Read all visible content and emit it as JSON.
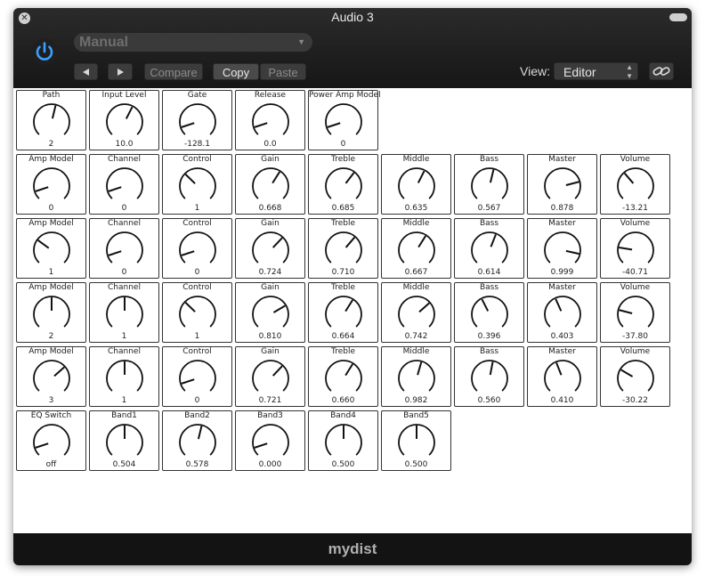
{
  "window": {
    "title": "Audio 3",
    "footer": "mydist"
  },
  "toolbar": {
    "preset": "Manual",
    "compare": "Compare",
    "copy": "Copy",
    "paste": "Paste",
    "view_label": "View:",
    "view_value": "Editor"
  },
  "knob_rows": [
    [
      {
        "label": "Path",
        "value": "2",
        "level": 0.55
      },
      {
        "label": "Input Level",
        "value": "10.0",
        "level": 0.6
      },
      {
        "label": "Gate",
        "value": "-128.1",
        "level": 0.1
      },
      {
        "label": "Release",
        "value": "0.0",
        "level": 0.1
      },
      {
        "label": "Power Amp Model",
        "value": "0",
        "level": 0.1
      }
    ],
    [
      {
        "label": "Amp Model",
        "value": "0",
        "level": 0.1
      },
      {
        "label": "Channel",
        "value": "0",
        "level": 0.1
      },
      {
        "label": "Control",
        "value": "1",
        "level": 0.33
      },
      {
        "label": "Gain",
        "value": "0.668",
        "level": 0.62
      },
      {
        "label": "Treble",
        "value": "0.685",
        "level": 0.64
      },
      {
        "label": "Middle",
        "value": "0.635",
        "level": 0.6
      },
      {
        "label": "Bass",
        "value": "0.567",
        "level": 0.55
      },
      {
        "label": "Master",
        "value": "0.878",
        "level": 0.78
      },
      {
        "label": "Volume",
        "value": "-13.21",
        "level": 0.35
      }
    ],
    [
      {
        "label": "Amp Model",
        "value": "1",
        "level": 0.3
      },
      {
        "label": "Channel",
        "value": "0",
        "level": 0.1
      },
      {
        "label": "Control",
        "value": "0",
        "level": 0.1
      },
      {
        "label": "Gain",
        "value": "0.724",
        "level": 0.66
      },
      {
        "label": "Treble",
        "value": "0.710",
        "level": 0.65
      },
      {
        "label": "Middle",
        "value": "0.667",
        "level": 0.62
      },
      {
        "label": "Bass",
        "value": "0.614",
        "level": 0.58
      },
      {
        "label": "Master",
        "value": "0.999",
        "level": 0.88
      },
      {
        "label": "Volume",
        "value": "-40.71",
        "level": 0.2
      }
    ],
    [
      {
        "label": "Amp Model",
        "value": "2",
        "level": 0.5
      },
      {
        "label": "Channel",
        "value": "1",
        "level": 0.5
      },
      {
        "label": "Control",
        "value": "1",
        "level": 0.33
      },
      {
        "label": "Gain",
        "value": "0.810",
        "level": 0.72
      },
      {
        "label": "Treble",
        "value": "0.664",
        "level": 0.62
      },
      {
        "label": "Middle",
        "value": "0.742",
        "level": 0.68
      },
      {
        "label": "Bass",
        "value": "0.396",
        "level": 0.4
      },
      {
        "label": "Master",
        "value": "0.403",
        "level": 0.41
      },
      {
        "label": "Volume",
        "value": "-37.80",
        "level": 0.22
      }
    ],
    [
      {
        "label": "Amp Model",
        "value": "3",
        "level": 0.68
      },
      {
        "label": "Channel",
        "value": "1",
        "level": 0.5
      },
      {
        "label": "Control",
        "value": "0",
        "level": 0.1
      },
      {
        "label": "Gain",
        "value": "0.721",
        "level": 0.66
      },
      {
        "label": "Treble",
        "value": "0.660",
        "level": 0.62
      },
      {
        "label": "Middle",
        "value": "0.982",
        "level": 0.56
      },
      {
        "label": "Bass",
        "value": "0.560",
        "level": 0.54
      },
      {
        "label": "Master",
        "value": "0.410",
        "level": 0.42
      },
      {
        "label": "Volume",
        "value": "-30.22",
        "level": 0.28
      }
    ],
    [
      {
        "label": "EQ Switch",
        "value": "off",
        "level": 0.1
      },
      {
        "label": "Band1",
        "value": "0.504",
        "level": 0.5
      },
      {
        "label": "Band2",
        "value": "0.578",
        "level": 0.55
      },
      {
        "label": "Band3",
        "value": "0.000",
        "level": 0.1
      },
      {
        "label": "Band4",
        "value": "0.500",
        "level": 0.5
      },
      {
        "label": "Band5",
        "value": "0.500",
        "level": 0.5
      }
    ]
  ]
}
